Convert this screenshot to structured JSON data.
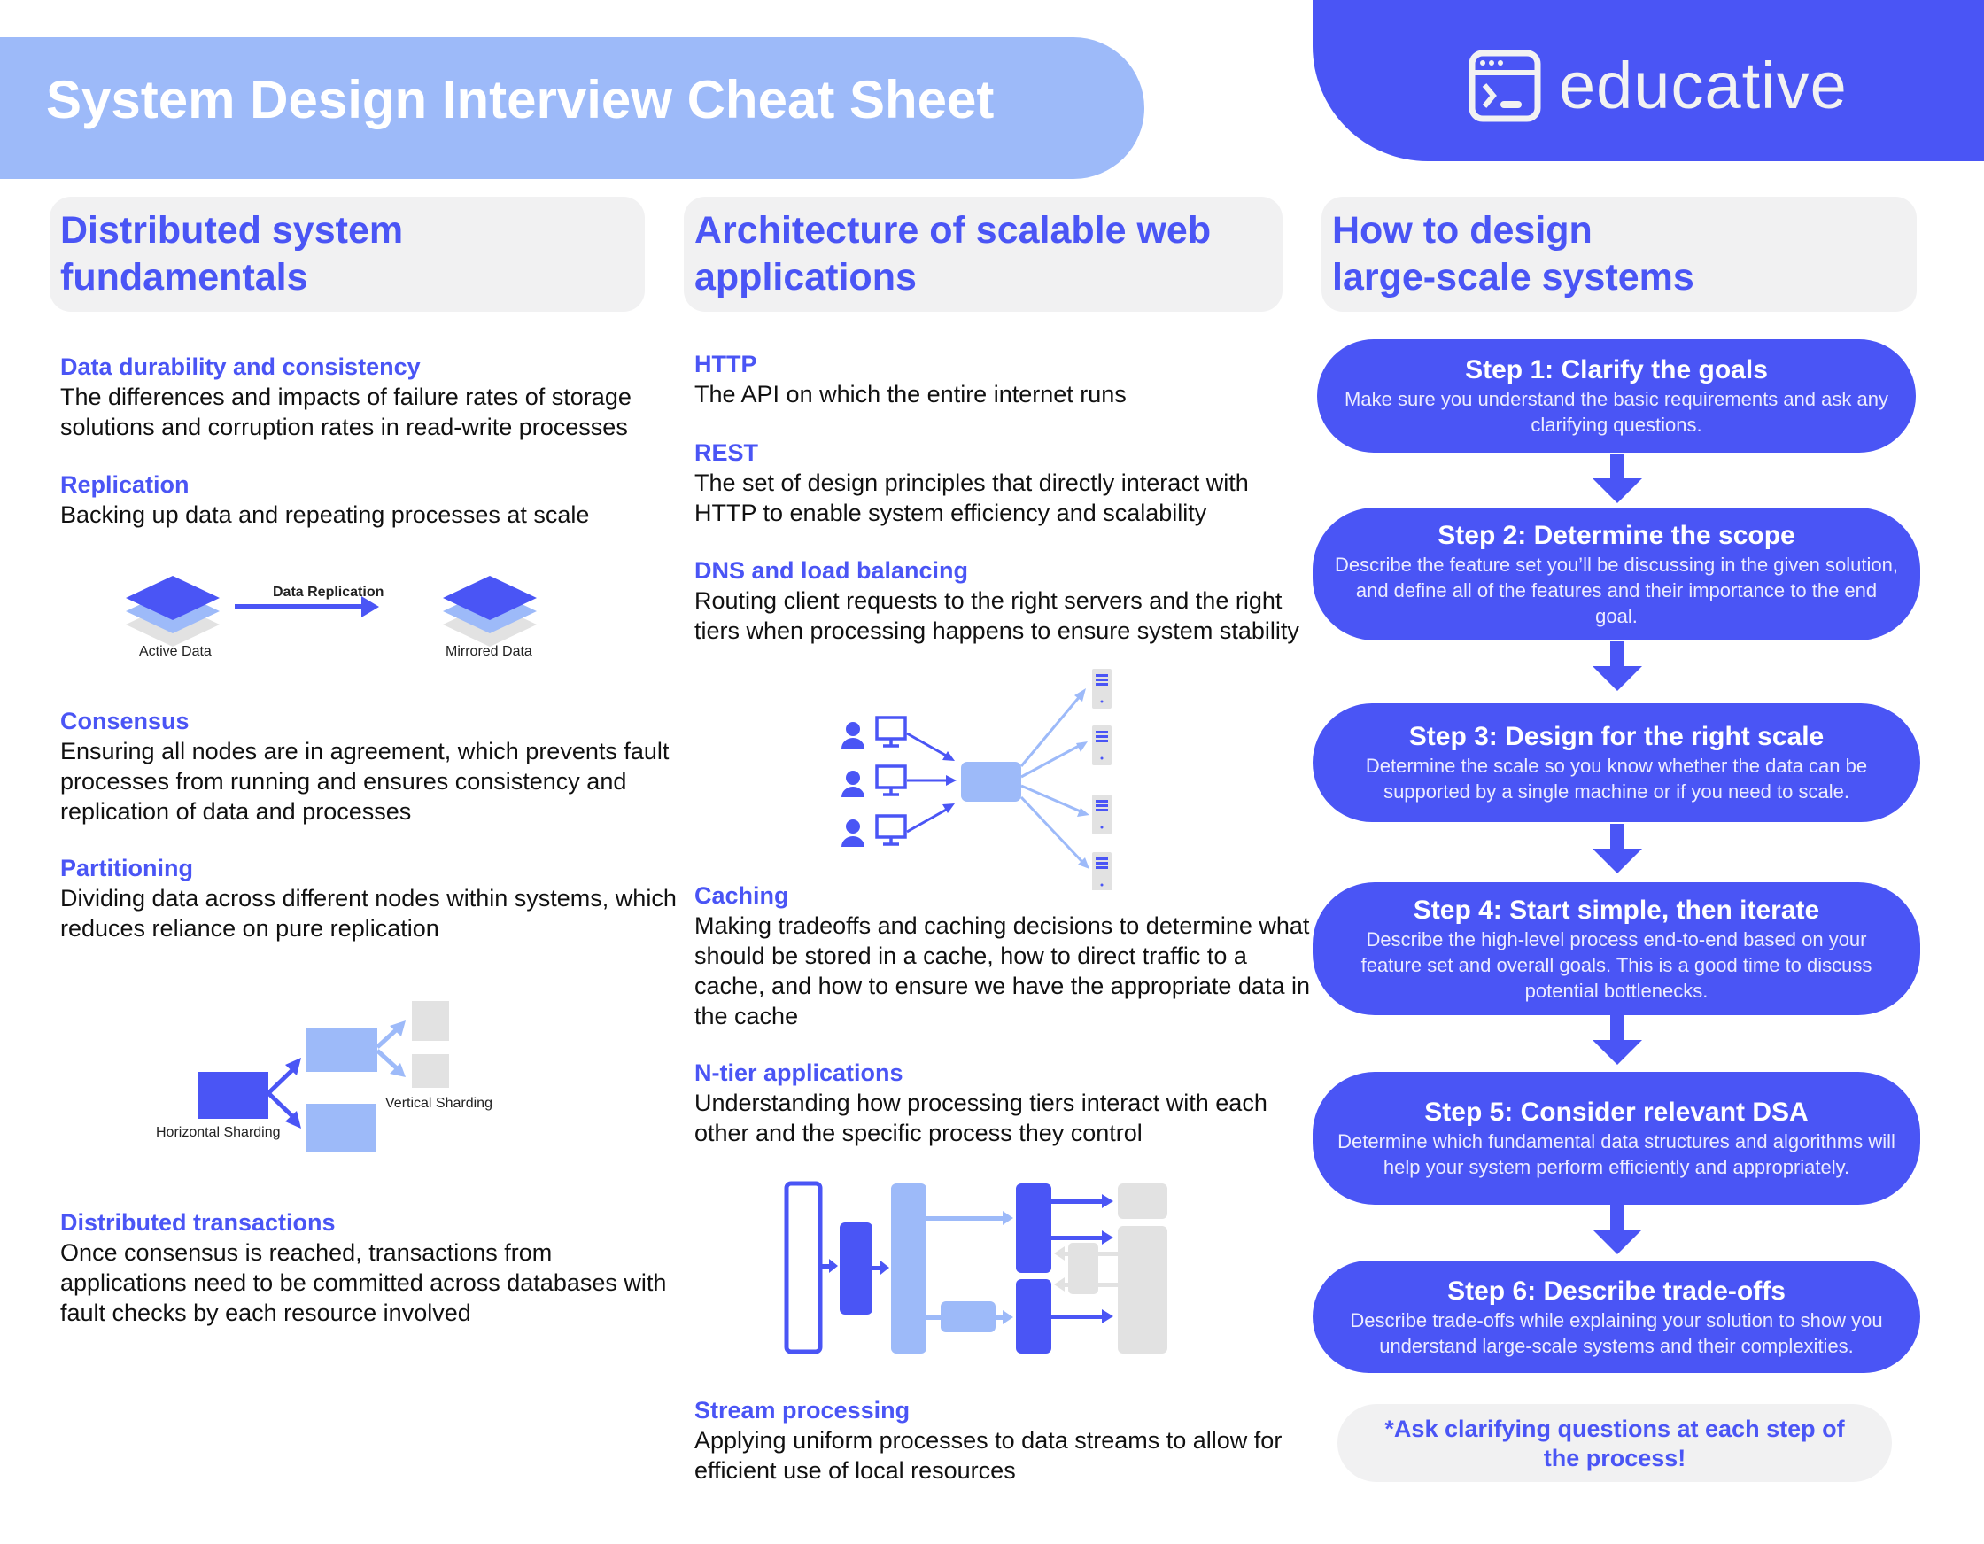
{
  "header": {
    "title": "System Design Interview Cheat Sheet",
    "brand": "educative",
    "brand_icon": "terminal-window-icon"
  },
  "colors": {
    "primary": "#4a55f5",
    "light_blue": "#9dbaf9",
    "gray": "#e2e2e2",
    "panel": "#f1f1f2"
  },
  "columns": [
    {
      "heading": "Distributed system\nfundamentals",
      "topics": [
        {
          "title": "Data durability and consistency",
          "desc": "The differences and impacts of failure rates of storage solutions and corruption rates in read-write processes"
        },
        {
          "title": "Replication",
          "desc": "Backing up data and repeating processes at scale"
        },
        {
          "title": "Consensus",
          "desc": "Ensuring all nodes are in agreement, which prevents fault processes from running and ensures consistency and replication of data and processes"
        },
        {
          "title": "Partitioning",
          "desc": "Dividing data across different nodes within systems, which reduces reliance on pure replication"
        },
        {
          "title": "Distributed transactions",
          "desc": "Once consensus is reached, transactions from applications need to be committed across databases with fault checks by each resource involved"
        }
      ],
      "diagrams": {
        "replication": {
          "arrow_label": "Data Replication",
          "left_label": "Active Data",
          "right_label": "Mirrored Data"
        },
        "sharding": {
          "horizontal_label": "Horizontal Sharding",
          "vertical_label": "Vertical Sharding"
        }
      }
    },
    {
      "heading": "Architecture of scalable web\napplications",
      "topics": [
        {
          "title": "HTTP",
          "desc": "The API on which the entire internet runs"
        },
        {
          "title": "REST",
          "desc": "The set of design principles that directly interact with HTTP to enable system efficiency and scalability"
        },
        {
          "title": "DNS and load balancing",
          "desc": "Routing client requests to the right servers and the right tiers when processing happens to ensure system stability"
        },
        {
          "title": "Caching",
          "desc": "Making tradeoffs and caching decisions to determine what should be stored in a cache, how to direct traffic to a cache, and how to ensure we have the appropriate data in the cache"
        },
        {
          "title": "N-tier applications",
          "desc": "Understanding how processing tiers interact with each other and the specific process they control"
        },
        {
          "title": "Stream processing",
          "desc": "Applying uniform processes to data streams to allow for efficient use of local resources"
        }
      ]
    },
    {
      "heading": "How to design\nlarge-scale systems",
      "steps": [
        {
          "title": "Step 1: Clarify the goals",
          "desc": "Make sure you understand the basic requirements and ask any clarifying questions."
        },
        {
          "title": "Step 2: Determine the scope",
          "desc": "Describe the feature set you’ll be discussing in the given solution, and define all of the features and their importance to the end goal."
        },
        {
          "title": "Step 3: Design for the right scale",
          "desc": "Determine the scale so you know whether the data can be supported by a single machine or if you need to scale."
        },
        {
          "title": "Step 4: Start simple, then iterate",
          "desc": "Describe the high-level process end-to-end based on your feature set and overall goals. This is a good time to discuss potential bottlenecks."
        },
        {
          "title": "Step 5: Consider relevant DSA",
          "desc": "Determine which fundamental data structures and algorithms will help your system perform efficiently and appropriately."
        },
        {
          "title": "Step 6: Describe trade-offs",
          "desc": "Describe trade-offs while explaining your solution to show you understand large-scale systems and their complexities."
        }
      ],
      "note": "*Ask clarifying questions at each step of the process!"
    }
  ]
}
